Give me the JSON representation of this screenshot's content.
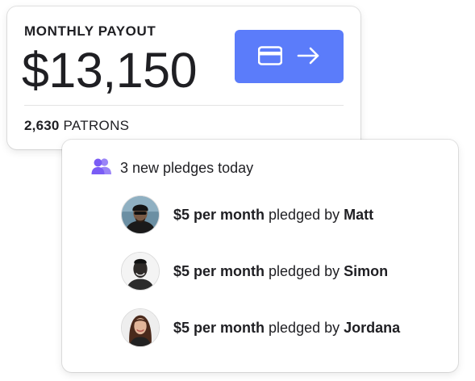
{
  "colors": {
    "accent": "#5b7cfa",
    "icon_purple": "#7a5cf5",
    "text": "#1f1f23",
    "divider": "#e3e3e3"
  },
  "payout": {
    "title": "MONTHLY PAYOUT",
    "amount": "$13,150",
    "button_icons": [
      "credit-card-icon",
      "arrow-right-icon"
    ],
    "patrons_count": "2,630",
    "patrons_label": "PATRONS"
  },
  "pledges": {
    "header_icon": "users-icon",
    "header": "3 new pledges today",
    "items": [
      {
        "amount": "$5 per month",
        "text": "pledged by",
        "name": "Matt"
      },
      {
        "amount": "$5 per month",
        "text": "pledged by",
        "name": "Simon"
      },
      {
        "amount": "$5 per month",
        "text": "pledged by",
        "name": "Jordana"
      }
    ]
  }
}
